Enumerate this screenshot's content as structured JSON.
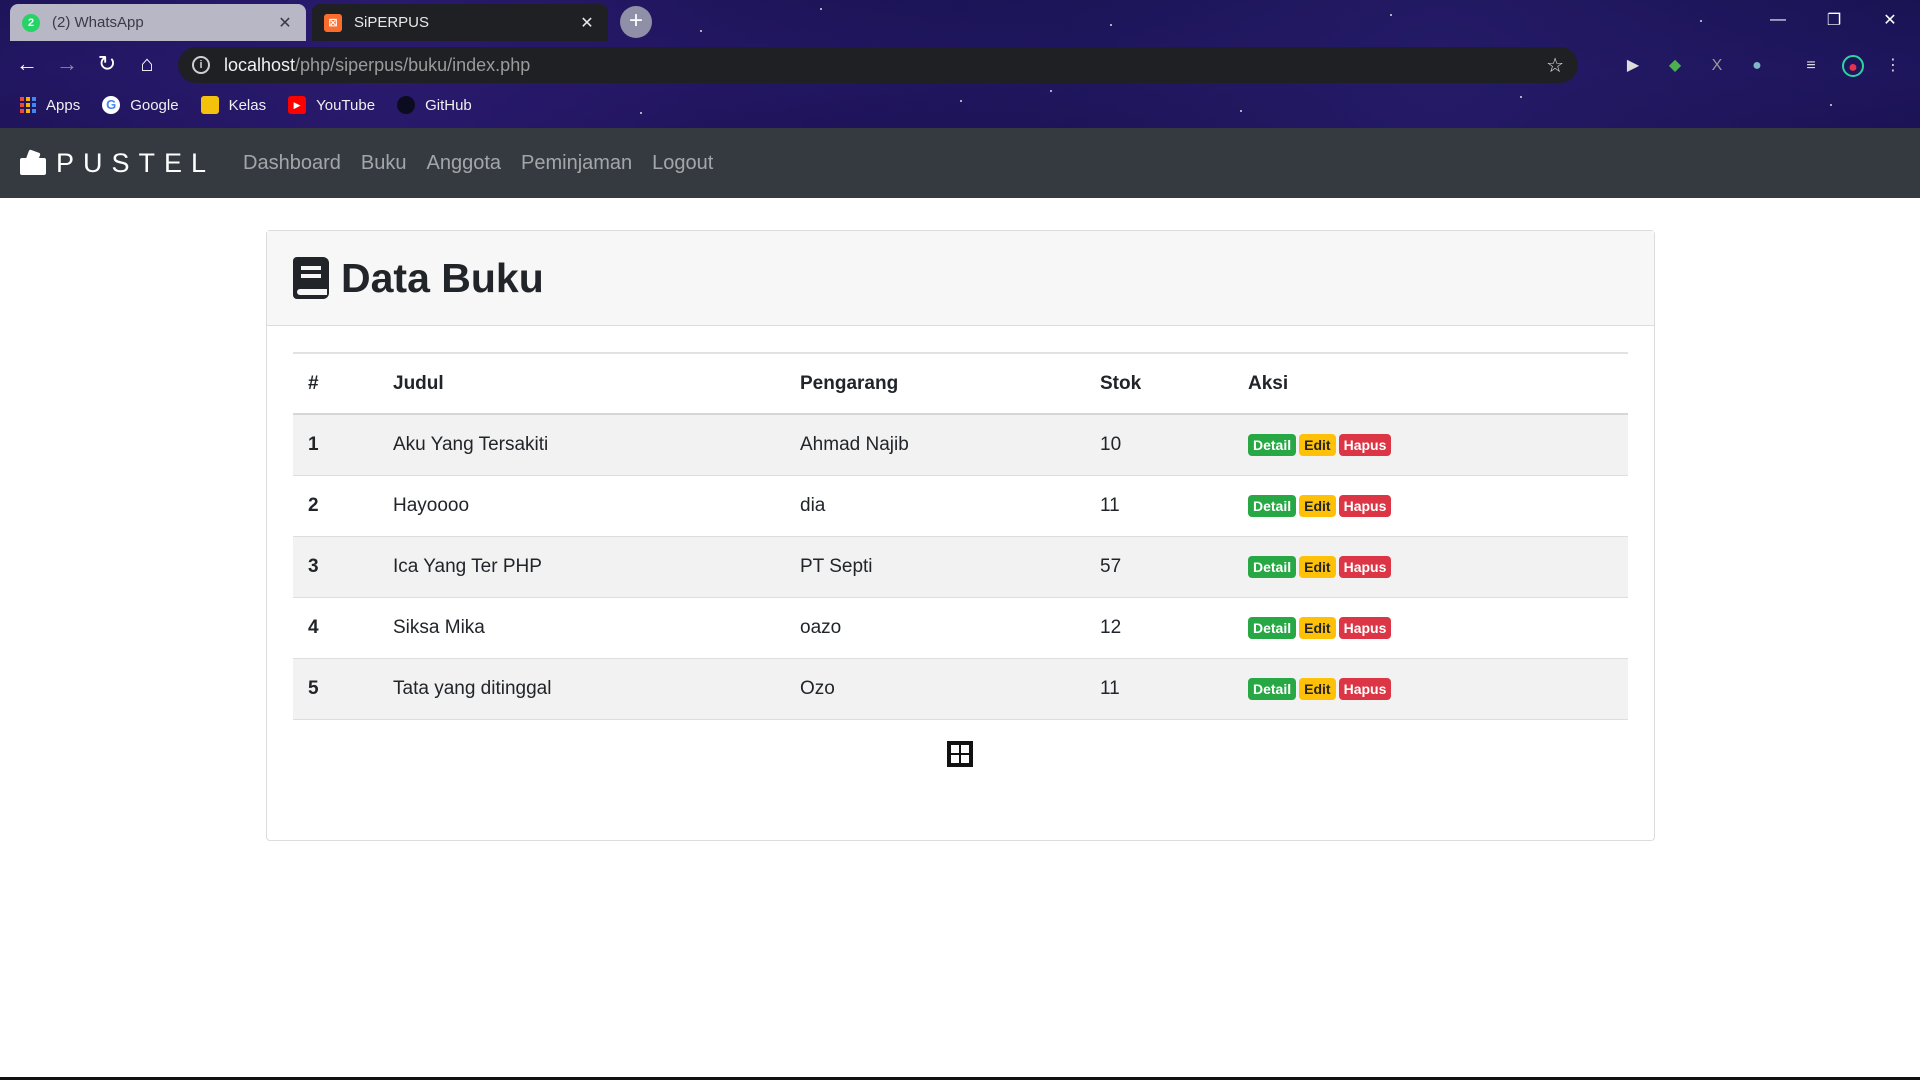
{
  "browser": {
    "tabs": [
      {
        "title": "(2) WhatsApp",
        "badge": "2"
      },
      {
        "title": "SiPERPUS"
      }
    ],
    "url_host": "localhost",
    "url_path": "/php/siperpus/buku/index.php",
    "bookmarks": [
      "Apps",
      "Google",
      "Kelas",
      "YouTube",
      "GitHub"
    ]
  },
  "navbar": {
    "brand": "PUSTEL",
    "links": [
      "Dashboard",
      "Buku",
      "Anggota",
      "Peminjaman",
      "Logout"
    ]
  },
  "page": {
    "title": "Data Buku",
    "columns": [
      "#",
      "Judul",
      "Pengarang",
      "Stok",
      "Aksi"
    ],
    "actions": {
      "detail": "Detail",
      "edit": "Edit",
      "hapus": "Hapus"
    },
    "rows": [
      {
        "no": "1",
        "judul": "Aku Yang Tersakiti",
        "pengarang": "Ahmad Najib",
        "stok": "10"
      },
      {
        "no": "2",
        "judul": "Hayoooo",
        "pengarang": "dia",
        "stok": "11"
      },
      {
        "no": "3",
        "judul": "Ica Yang Ter PHP",
        "pengarang": "PT Septi",
        "stok": "57"
      },
      {
        "no": "4",
        "judul": "Siksa Mika",
        "pengarang": "oazo",
        "stok": "12"
      },
      {
        "no": "5",
        "judul": "Tata yang ditinggal",
        "pengarang": "Ozo",
        "stok": "11"
      }
    ]
  },
  "colors": {
    "navbar_bg": "#343a40",
    "detail": "#28a745",
    "edit": "#ffc107",
    "hapus": "#dc3545"
  }
}
